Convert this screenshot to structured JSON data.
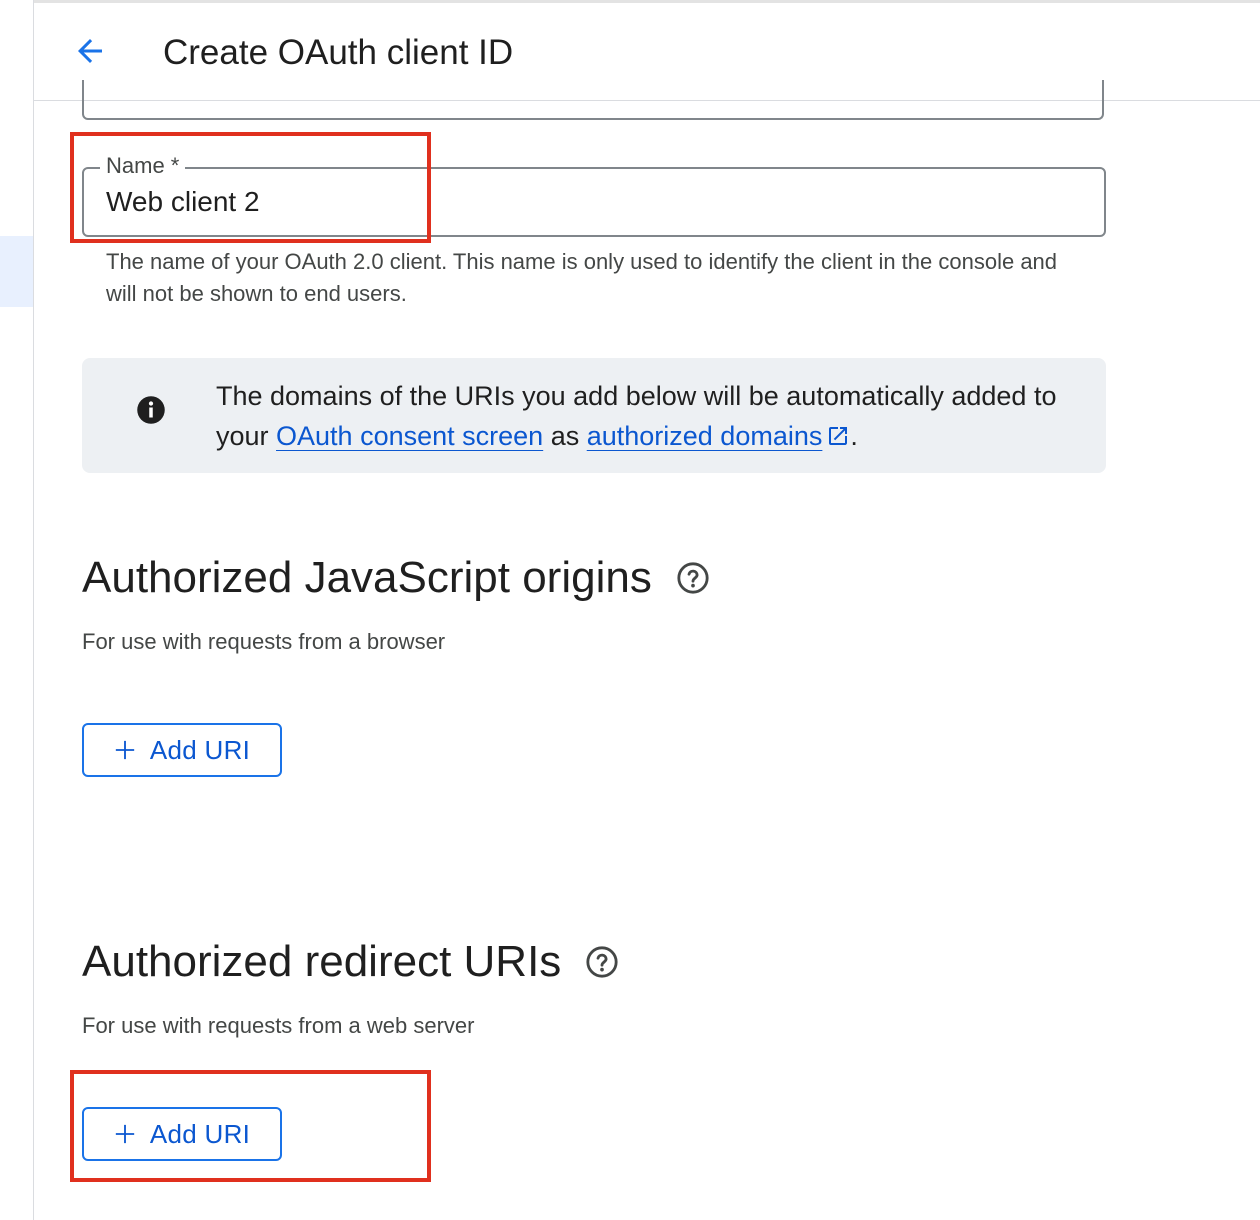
{
  "header": {
    "title": "Create OAuth client ID",
    "back_icon": "arrow-back-icon"
  },
  "name_field": {
    "label": "Name *",
    "value": "Web client 2",
    "helper": "The name of your OAuth 2.0 client. This name is only used to identify the client in the console and will not be shown to end users."
  },
  "info_banner": {
    "icon": "info-icon",
    "text_before": "The domains of the URIs you add below will be automatically added to your ",
    "link1": "OAuth consent screen",
    "text_middle": " as ",
    "link2": "authorized domains",
    "text_after": "."
  },
  "js_origins": {
    "title": "Authorized JavaScript origins",
    "subtitle": "For use with requests from a browser",
    "button_label": "Add URI"
  },
  "redirect_uris": {
    "title": "Authorized redirect URIs",
    "subtitle": "For use with requests from a web server",
    "button_label": "Add URI"
  },
  "colors": {
    "accent": "#0b57d0",
    "highlight": "#e0301e",
    "info_bg": "#edf0f3"
  }
}
